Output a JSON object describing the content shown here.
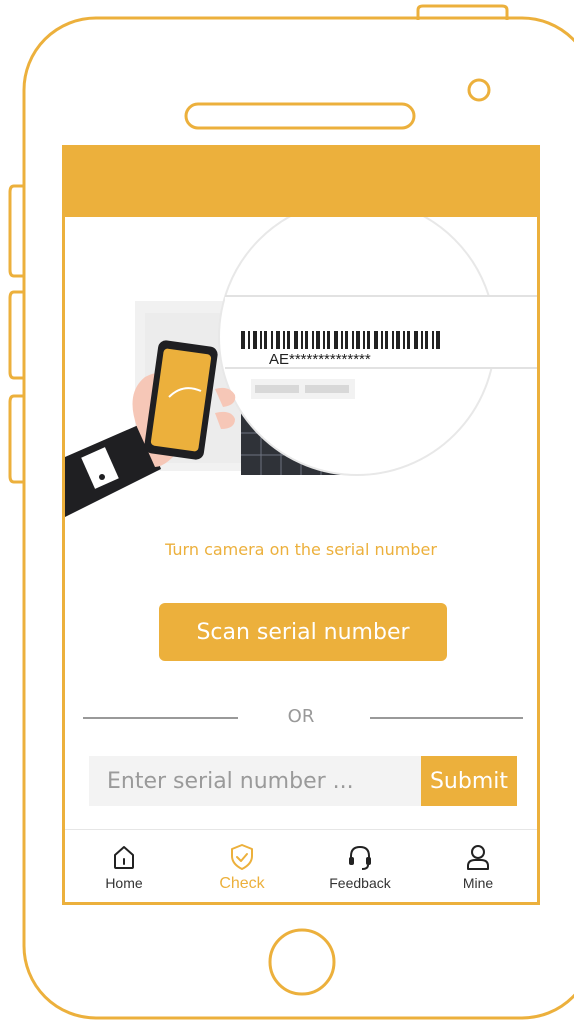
{
  "theme": {
    "accent": "#ECB03C",
    "text_dark": "#333333",
    "text_muted": "#999999",
    "input_bg": "#f3f3f3"
  },
  "illustration": {
    "serial_text": "AE**************"
  },
  "scan": {
    "hint": "Turn camera on the serial number",
    "button_label": "Scan serial number"
  },
  "separator": {
    "label": "OR"
  },
  "manual_entry": {
    "placeholder": "Enter serial number ...",
    "value": "",
    "submit_label": "Submit"
  },
  "tabbar": {
    "items": [
      {
        "label": "Home",
        "icon": "home-icon",
        "active": false
      },
      {
        "label": "Check",
        "icon": "shield-check-icon",
        "active": true
      },
      {
        "label": "Feedback",
        "icon": "headset-icon",
        "active": false
      },
      {
        "label": "Mine",
        "icon": "user-icon",
        "active": false
      }
    ]
  }
}
